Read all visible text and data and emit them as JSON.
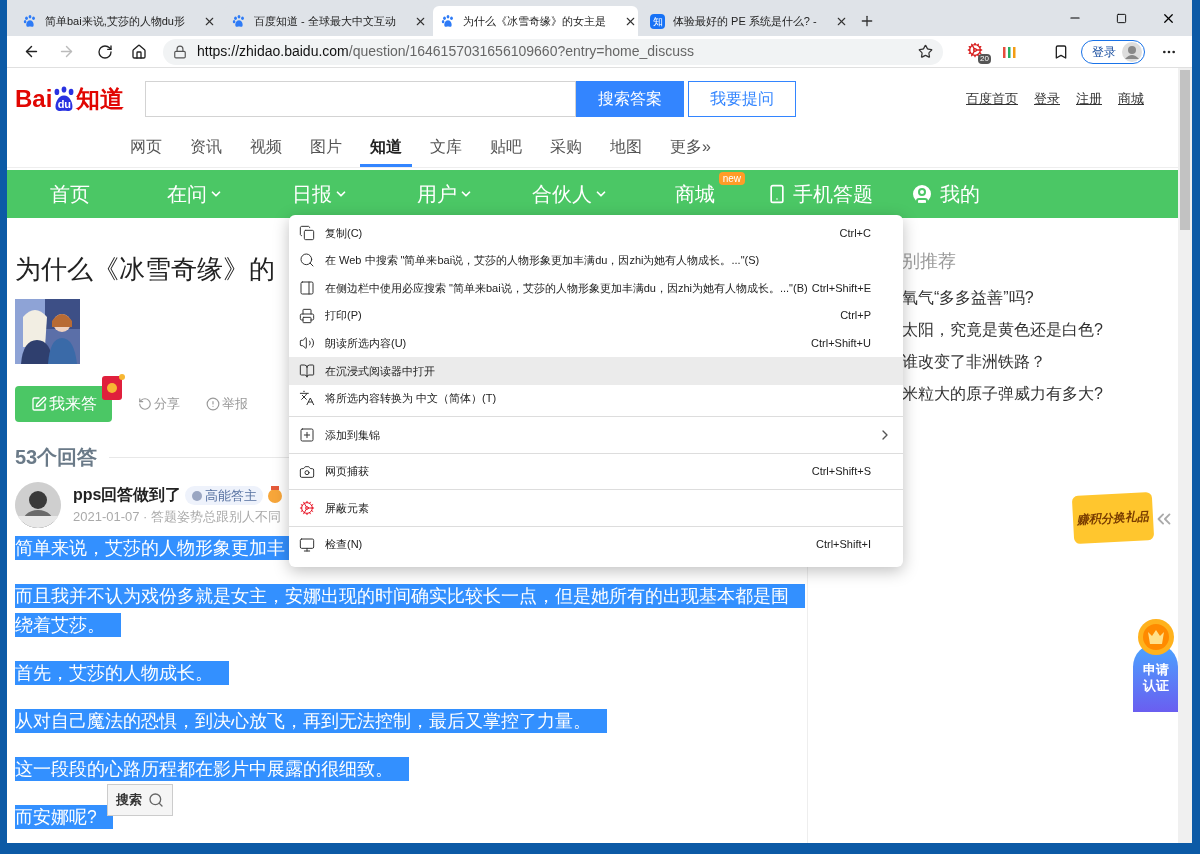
{
  "tabs": [
    {
      "title": "简单bai来说,艾莎的人物du形",
      "selected": false
    },
    {
      "title": "百度知道 - 全球最大中文互动",
      "selected": false
    },
    {
      "title": "为什么《冰雪奇缘》的女主是",
      "selected": true
    },
    {
      "title": "体验最好的 PE 系统是什么? -",
      "favicon_text": "知",
      "selected": false
    }
  ],
  "toolbar": {
    "url_host": "https://zhidao.baidu.com",
    "url_path": "/question/1646157031656109660?entry=home_discuss",
    "extension_badge": "20",
    "login": "登录"
  },
  "header": {
    "logo": {
      "part1": "Bai",
      "part2": "du",
      "part3": "知道"
    },
    "search_button": "搜索答案",
    "ask_button": "我要提问",
    "links": [
      "百度首页",
      "登录",
      "注册",
      "商城"
    ]
  },
  "channels": [
    {
      "label": "网页",
      "selected": false
    },
    {
      "label": "资讯",
      "selected": false
    },
    {
      "label": "视频",
      "selected": false
    },
    {
      "label": "图片",
      "selected": false
    },
    {
      "label": "知道",
      "selected": true
    },
    {
      "label": "文库",
      "selected": false
    },
    {
      "label": "贴吧",
      "selected": false
    },
    {
      "label": "采购",
      "selected": false
    },
    {
      "label": "地图",
      "selected": false
    },
    {
      "label": "更多»",
      "selected": false
    }
  ],
  "green_nav": [
    {
      "label": "首页",
      "kind": "plain"
    },
    {
      "label": "在问",
      "kind": "caret"
    },
    {
      "label": "日报",
      "kind": "caret"
    },
    {
      "label": "用户",
      "kind": "caret"
    },
    {
      "label": "合伙人",
      "kind": "caret"
    },
    {
      "label": "商城",
      "kind": "badge",
      "badge": "new"
    },
    {
      "label": "手机答题",
      "kind": "phone"
    },
    {
      "label": "我的",
      "kind": "user"
    }
  ],
  "question": {
    "title": "为什么《冰雪奇缘》的",
    "answer_button": "我来答",
    "actions": [
      {
        "label": "分享",
        "kind": "share"
      },
      {
        "label": "举报",
        "kind": "report"
      }
    ],
    "answer_count": "53个回答"
  },
  "answer": {
    "author": "pps回答做到了",
    "badge": "高能答主",
    "meta": "2021-01-07 · 答题姿势总跟别人不同",
    "paragraphs": [
      {
        "text": "简单来说，艾莎的人物形象更加丰",
        "selected": true
      },
      {
        "text": "而且我并不认为戏份多就是女主，安娜出现的时间确实比较长一点，但是她所有的出现基本都是围绕着艾莎。",
        "selected": true
      },
      {
        "text": "首先，艾莎的人物成长。",
        "selected": true
      },
      {
        "text": "从对自己魔法的恐惧，到决心放飞，再到无法控制，最后又掌控了力量。",
        "selected": true
      },
      {
        "text": "这一段段的心路历程都在影片中展露的很细致。",
        "selected": true
      },
      {
        "text": "而安娜呢?",
        "selected": true
      }
    ]
  },
  "sidebar": {
    "heading": "别推荐",
    "items": [
      "氧气“多多益善”吗?",
      "太阳，究竟是黄色还是白色?",
      "谁改变了非洲铁路？",
      "米粒大的原子弹威力有多大?"
    ]
  },
  "context_menu": [
    [
      {
        "label": "复制(C)",
        "shortcut": "Ctrl+C",
        "selected": false
      },
      {
        "label": "在 Web 中搜索 \"简单来bai说，艾莎的人物形象更加丰满du，因zhi为她有人物成长。...\"(S)",
        "selected": false
      },
      {
        "label": "在侧边栏中使用必应搜索 \"简单来bai说，艾莎的人物形象更加丰满du，因zhi为她有人物成长。...\"(B)",
        "shortcut": "Ctrl+Shift+E",
        "selected": false
      },
      {
        "label": "打印(P)",
        "shortcut": "Ctrl+P",
        "selected": false
      },
      {
        "label": "朗读所选内容(U)",
        "shortcut": "Ctrl+Shift+U",
        "selected": false
      },
      {
        "label": "在沉浸式阅读器中打开",
        "selected": true
      },
      {
        "label": "将所选内容转换为 中文（简体）(T)",
        "selected": false
      }
    ],
    [
      {
        "label": "添加到集锦",
        "submenu": true,
        "selected": false
      }
    ],
    [
      {
        "label": "网页捕获",
        "shortcut": "Ctrl+Shift+S",
        "selected": false
      }
    ],
    [
      {
        "label": "屏蔽元素",
        "selected": false
      }
    ],
    [
      {
        "label": "检查(N)",
        "shortcut": "Ctrl+Shift+I",
        "selected": false
      }
    ]
  ],
  "floating": {
    "points": "赚积分换礼品",
    "certify": "申请认证",
    "search_tip": "搜索"
  }
}
